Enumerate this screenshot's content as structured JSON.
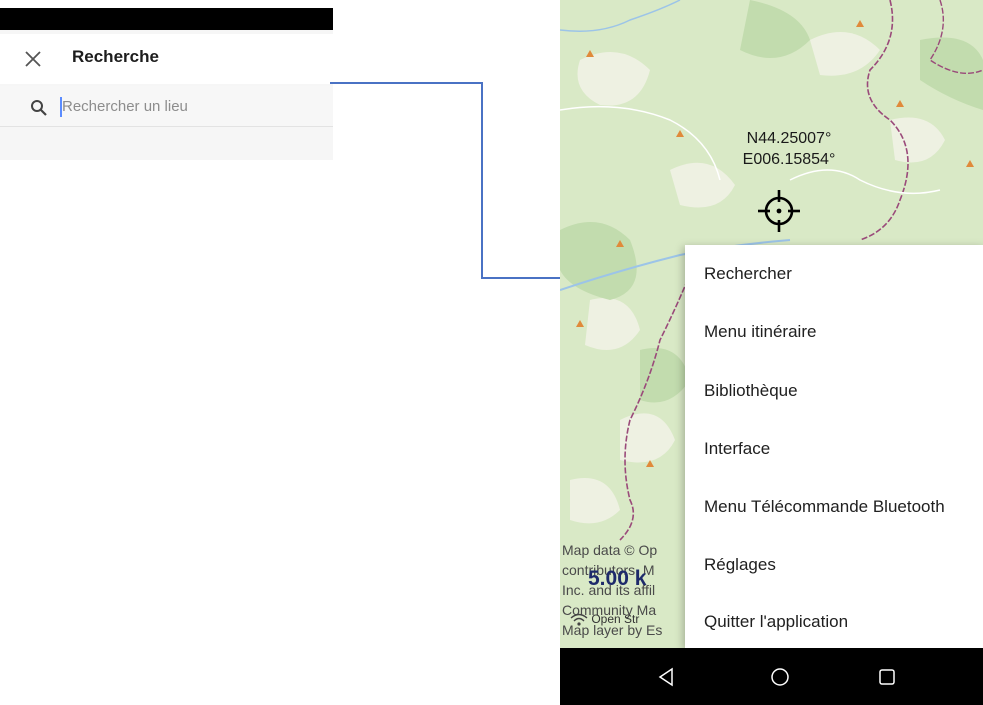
{
  "search_screen": {
    "title": "Recherche",
    "placeholder": "Rechercher un lieu"
  },
  "map": {
    "coord_lat": "N44.25007°",
    "coord_lon": "E006.15854°",
    "attribution_lines": [
      "Map data © Op",
      "contributors, M",
      "Inc. and its affil",
      "Community Ma",
      "Map layer by Es"
    ],
    "scale_label": "5.00 k",
    "network_label": "Open Str"
  },
  "menu": {
    "items": [
      "Rechercher",
      "Menu itinéraire",
      "Bibliothèque",
      "Interface",
      "Menu Télécommande Bluetooth",
      "Réglages",
      "Quitter l'application"
    ]
  },
  "colors": {
    "connector": "#4a72c4",
    "map_land": "#d9e9c6",
    "border_line": "#9a4a7a",
    "peak": "#e08a3a"
  },
  "icons": [
    "close-icon",
    "search-icon",
    "crosshair-icon",
    "wifi-icon",
    "back-icon",
    "home-icon",
    "recents-icon"
  ]
}
